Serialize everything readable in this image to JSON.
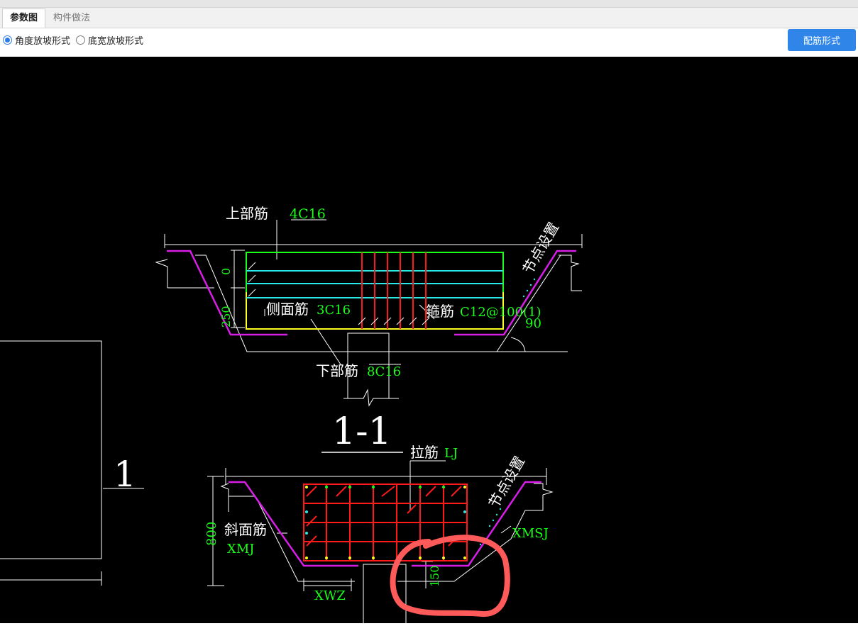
{
  "tabs": [
    {
      "label": "参数图",
      "active": true
    },
    {
      "label": "构件做法",
      "active": false
    }
  ],
  "options": {
    "angle_slope": {
      "label": "角度放坡形式",
      "selected": true
    },
    "width_slope": {
      "label": "底宽放坡形式",
      "selected": false
    }
  },
  "rebar_button": "配筋形式",
  "drawing": {
    "upper": {
      "top_bar_label": "上部筋",
      "top_bar_value": "4C16",
      "side_bar_label": "侧面筋",
      "side_bar_value": "3C16",
      "stirrup_label": "箍筋",
      "stirrup_value": "C12@100(1)",
      "bottom_bar_label": "下部筋",
      "bottom_bar_value": "8C16",
      "node_label": "节点设置",
      "angle_value": "90",
      "dim_top": "0",
      "dim_side": "250"
    },
    "section_title": "1-1",
    "side_marker": "1",
    "lower": {
      "tie_label": "拉筋",
      "tie_value": "LJ",
      "node_label": "节点设置",
      "incline_label": "斜面筋",
      "incline_value": "XMJ",
      "xmsj_value": "XMSJ",
      "xwz_value": "XWZ",
      "dim_height": "800",
      "dim_150": "150"
    }
  },
  "colors": {
    "accent": "#2f86e8",
    "green_text": "#19ff19",
    "rebar_red": "#ff1a1a",
    "magenta": "#d61ee6",
    "cyan": "#28e8e8",
    "yellow": "#ffff22",
    "annotation": "#ff5a5a"
  }
}
